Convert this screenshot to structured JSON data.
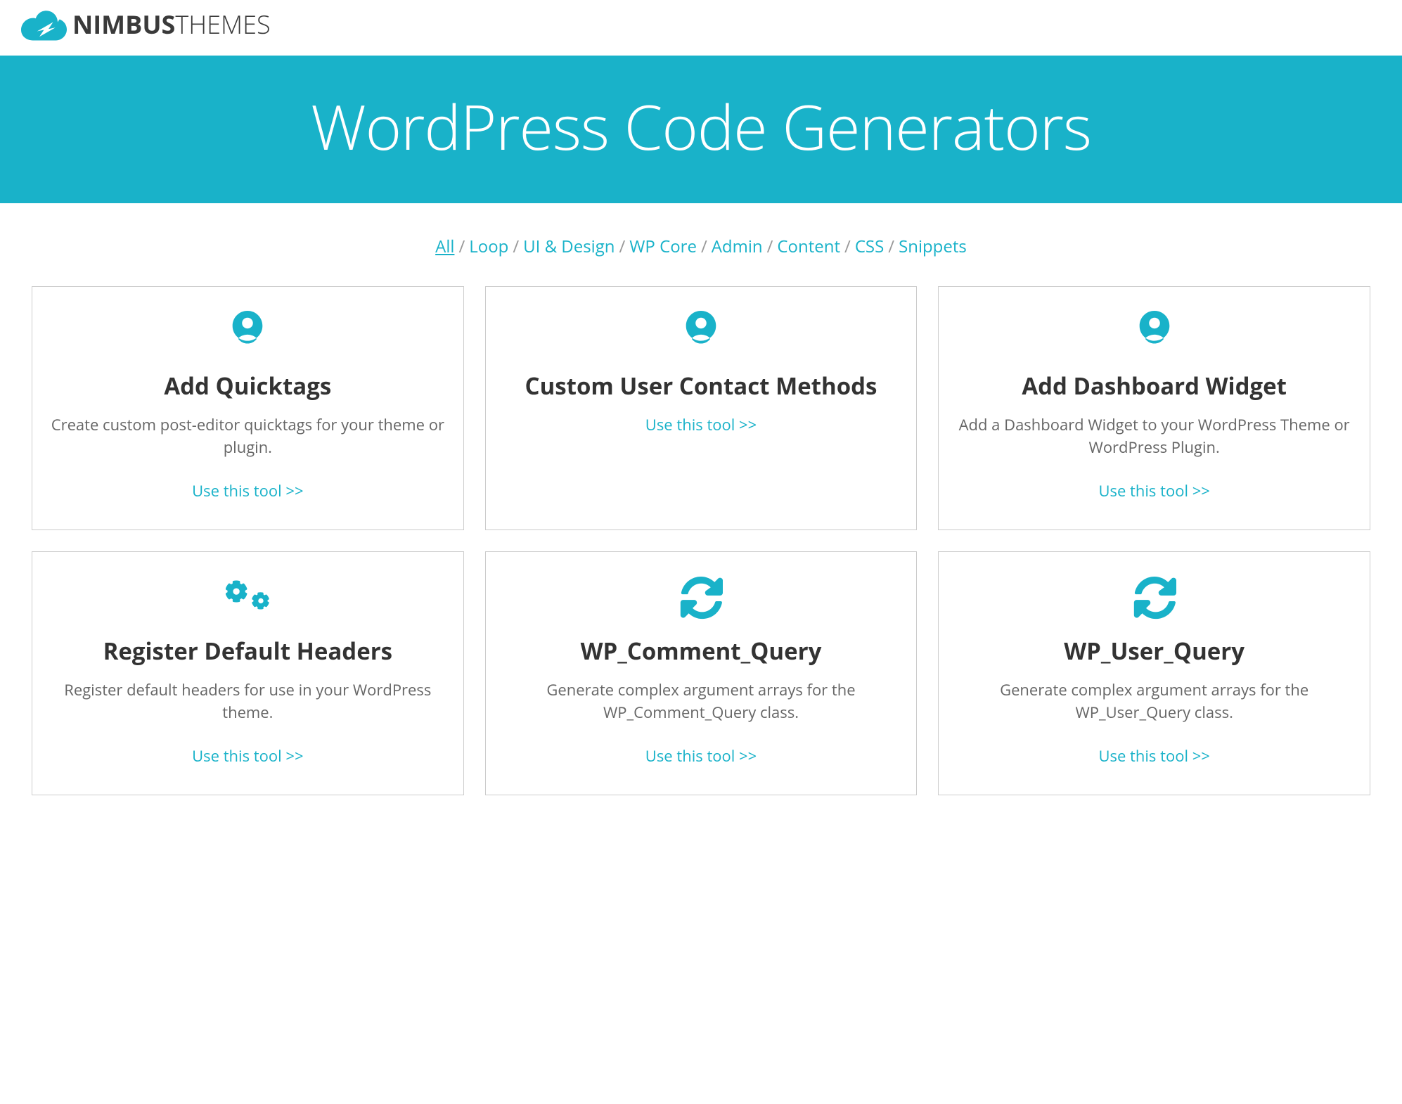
{
  "logo": {
    "bold": "NIMBUS",
    "light": "THEMES"
  },
  "banner": {
    "title": "WordPress Code Generators"
  },
  "filters": [
    {
      "label": "All",
      "active": true
    },
    {
      "label": "Loop"
    },
    {
      "label": "UI & Design"
    },
    {
      "label": "WP Core"
    },
    {
      "label": "Admin"
    },
    {
      "label": "Content"
    },
    {
      "label": "CSS"
    },
    {
      "label": "Snippets"
    }
  ],
  "link_label": "Use this tool >>",
  "cards": [
    {
      "icon": "user",
      "title": "Add Quicktags",
      "desc": "Create custom post-editor quicktags for your theme or plugin."
    },
    {
      "icon": "user",
      "title": "Custom User Contact Methods",
      "desc": ""
    },
    {
      "icon": "user",
      "title": "Add Dashboard Widget",
      "desc": "Add a Dashboard Widget to your WordPress Theme or WordPress Plugin."
    },
    {
      "icon": "gears",
      "title": "Register Default Headers",
      "desc": "Register default headers for use in your WordPress theme."
    },
    {
      "icon": "refresh",
      "title": "WP_Comment_Query",
      "desc": "Generate complex argument arrays for the WP_Comment_Query class."
    },
    {
      "icon": "refresh",
      "title": "WP_User_Query",
      "desc": "Generate complex argument arrays for the WP_User_Query class."
    }
  ]
}
